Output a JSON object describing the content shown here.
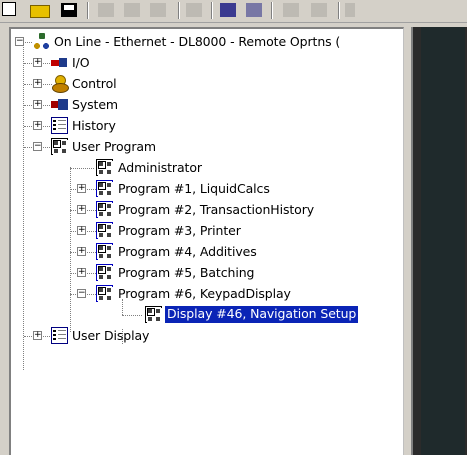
{
  "toolbar": {
    "buttons": [
      "new-icon",
      "open-folder-icon",
      "save-disk-icon",
      "cut-icon",
      "copy-icon",
      "paste-icon",
      "print-icon",
      "download-icon",
      "compile-icon",
      "search-icon",
      "search-next-icon",
      "variable-icon"
    ]
  },
  "tree": {
    "root": {
      "label": "On Line - Ethernet - DL8000 - Remote Oprtns (",
      "icon": "network-icon"
    },
    "items": [
      {
        "label": "I/O",
        "icon": "io-icon"
      },
      {
        "label": "Control",
        "icon": "control-icon"
      },
      {
        "label": "System",
        "icon": "system-icon"
      },
      {
        "label": "History",
        "icon": "history-icon"
      },
      {
        "label": "User Program",
        "icon": "program-icon"
      },
      {
        "label": "Administrator",
        "icon": "program-icon"
      },
      {
        "label": "Program #1, LiquidCalcs",
        "icon": "program-icon"
      },
      {
        "label": "Program #2, TransactionHistory",
        "icon": "program-icon"
      },
      {
        "label": "Program #3, Printer",
        "icon": "program-icon"
      },
      {
        "label": "Program #4, Additives",
        "icon": "program-icon"
      },
      {
        "label": "Program #5, Batching",
        "icon": "program-icon"
      },
      {
        "label": "Program #6, KeypadDisplay",
        "icon": "program-icon"
      },
      {
        "label": "Display #46, Navigation Setup",
        "icon": "program-icon",
        "selected": true
      },
      {
        "label": "User Display",
        "icon": "display-icon"
      }
    ]
  },
  "colors": {
    "selection": "#0a24b6",
    "panel": "#d4d0c8"
  }
}
